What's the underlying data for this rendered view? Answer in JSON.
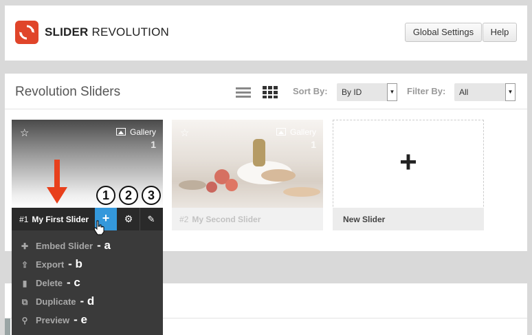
{
  "header": {
    "brand_bold": "SLIDER",
    "brand_rest": " REVOLUTION",
    "global_settings_label": "Global Settings",
    "help_label": "Help"
  },
  "main": {
    "title": "Revolution Sliders",
    "sort_label": "Sort By:",
    "sort_value": "By ID",
    "filter_label": "Filter By:",
    "filter_value": "All"
  },
  "sliders": [
    {
      "num": "#1",
      "name": "My First Slider",
      "type": "Gallery",
      "count": "1"
    },
    {
      "num": "#2",
      "name": "My Second Slider",
      "type": "Gallery",
      "count": "1"
    }
  ],
  "new_slider": {
    "label": "New Slider"
  },
  "menu": [
    {
      "label": "Embed Slider",
      "anno": "- a",
      "icon": "plus-icon"
    },
    {
      "label": "Export",
      "anno": "- b",
      "icon": "export-icon"
    },
    {
      "label": "Delete",
      "anno": "- c",
      "icon": "trash-icon"
    },
    {
      "label": "Duplicate",
      "anno": "- d",
      "icon": "duplicate-icon"
    },
    {
      "label": "Preview",
      "anno": "- e",
      "icon": "magnifier-icon"
    }
  ],
  "annotations": {
    "n1": "1",
    "n2": "2",
    "n3": "3"
  },
  "colors": {
    "accent": "#3498db",
    "logo": "#e0452a",
    "arrow": "#e8401c"
  }
}
